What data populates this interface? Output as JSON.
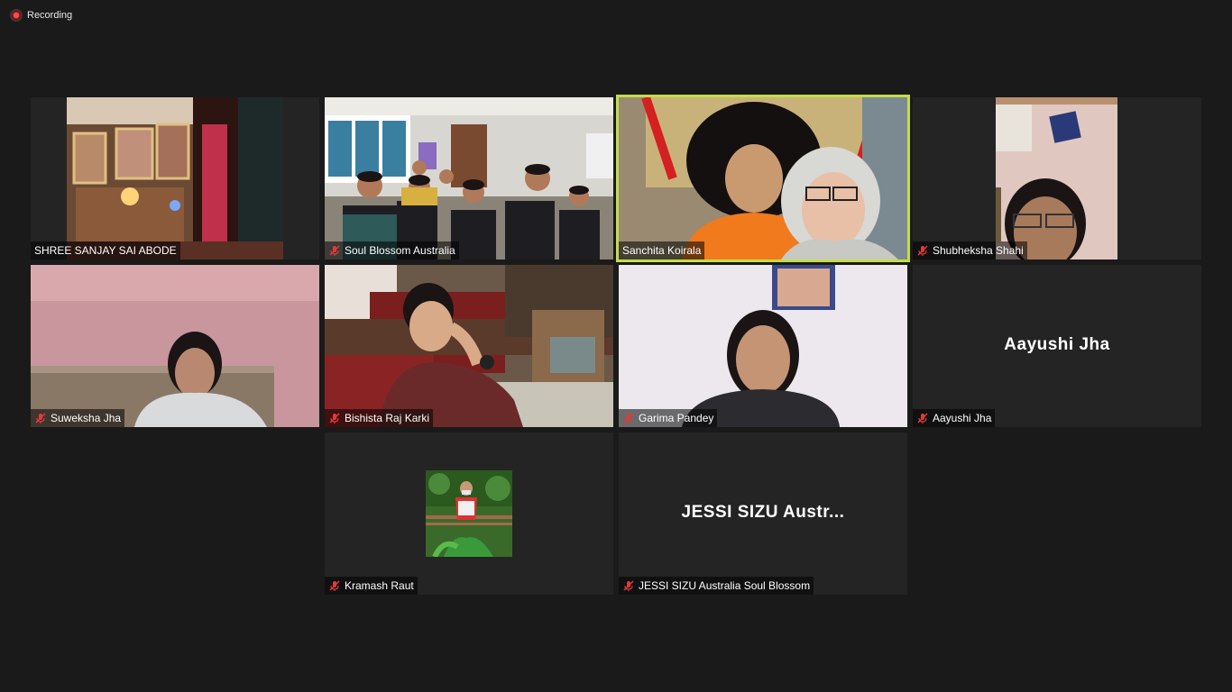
{
  "recording": {
    "label": "Recording"
  },
  "participants": [
    {
      "name": "SHREE SANJAY SAI ABODE",
      "muted": false,
      "active": false
    },
    {
      "name": "Soul Blossom Australia",
      "muted": true,
      "active": false
    },
    {
      "name": "Sanchita Koirala",
      "muted": false,
      "active": true
    },
    {
      "name": "Shubheksha Shahi",
      "muted": true,
      "active": false
    },
    {
      "name": "Suweksha Jha",
      "muted": true,
      "active": false
    },
    {
      "name": "Bishista Raj Karki",
      "muted": true,
      "active": false
    },
    {
      "name": "Garima Pandey",
      "muted": true,
      "active": false
    },
    {
      "name": "Aayushi Jha",
      "muted": true,
      "active": false,
      "display_name": "Aayushi Jha"
    },
    {
      "name": "Kramash Raut",
      "muted": true,
      "active": false
    },
    {
      "name": "JESSI SIZU Australia Soul Blossom",
      "muted": true,
      "active": false,
      "display_name": "JESSI SIZU Austr..."
    }
  ],
  "colors": {
    "background": "#1a1a1a",
    "tile": "#242424",
    "active_border": "#c4dd4a",
    "muted_icon": "#e0393e"
  },
  "icons": {
    "recording": "record-dot-icon",
    "muted": "mic-off-icon"
  }
}
